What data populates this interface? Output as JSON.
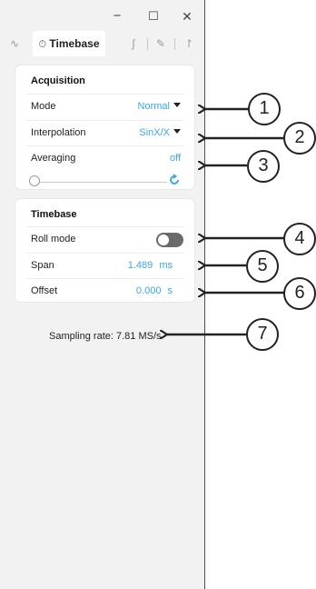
{
  "window": {
    "minimize_glyph": "−",
    "maximize_glyph": "☐",
    "close_glyph": "✕"
  },
  "tabs": [
    {
      "icon": "sine-wave-icon",
      "glyph": "∿",
      "label": ""
    },
    {
      "icon": "clock-icon",
      "glyph": "⏱",
      "label": "Timebase",
      "active": true
    },
    {
      "icon": "integral-icon",
      "glyph": "∫",
      "label": ""
    },
    {
      "icon": "pencil-icon",
      "glyph": "✎",
      "label": ""
    },
    {
      "icon": "trigger-icon",
      "glyph": "↾",
      "label": ""
    }
  ],
  "acquisition": {
    "title": "Acquisition",
    "mode_label": "Mode",
    "mode_value": "Normal",
    "interpolation_label": "Interpolation",
    "interpolation_value": "SinX/X",
    "averaging_label": "Averaging",
    "averaging_value": "off",
    "averaging_level": 0
  },
  "timebase": {
    "title": "Timebase",
    "roll_mode_label": "Roll mode",
    "roll_mode_on": false,
    "span_label": "Span",
    "span_value": "1.489",
    "span_unit": "ms",
    "offset_label": "Offset",
    "offset_value": "0.000",
    "offset_unit": "s"
  },
  "sampling_rate": "Sampling rate: 7.81 MS/s",
  "callouts": [
    "1",
    "2",
    "3",
    "4",
    "5",
    "6",
    "7"
  ],
  "colors": {
    "accent": "#3aa7e6",
    "panel_bg": "#f2f2f2",
    "card_bg": "#ffffff",
    "toggle_off": "#6b6b6b"
  }
}
